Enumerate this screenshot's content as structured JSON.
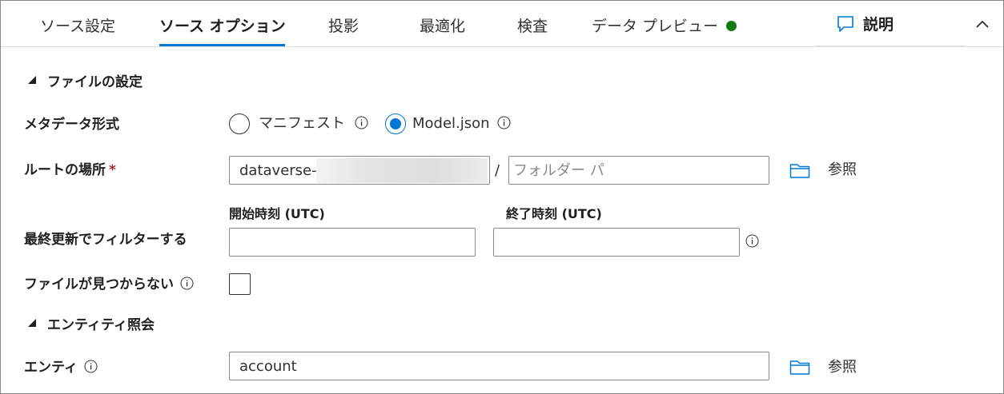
{
  "tabs": [
    {
      "label": "ソース設定",
      "active": false
    },
    {
      "label": "ソース オプション",
      "active": true
    },
    {
      "label": "投影",
      "active": false
    },
    {
      "label": "最適化",
      "active": false
    },
    {
      "label": "検査",
      "active": false
    },
    {
      "label": "データ プレビュー",
      "active": false,
      "status": "green"
    }
  ],
  "explain": {
    "label": "説明",
    "icon": "chat-bubble-icon"
  },
  "collapse": {
    "icon": "chevron-up-icon"
  },
  "file_settings": {
    "heading": "ファイルの設定",
    "metadata_format": {
      "label": "メタデータ形式",
      "options": [
        {
          "label": "マニフェスト",
          "selected": false
        },
        {
          "label": "Model.json",
          "selected": true
        }
      ]
    },
    "root_location": {
      "label": "ルートの場所",
      "required_mark": "*",
      "container_value": "dataverse-",
      "separator": "/",
      "folder_placeholder": "フォルダー パ",
      "browse_label": "参照"
    },
    "filter_last_modified": {
      "label": "最終更新でフィルターする",
      "start_label": "開始時刻 (UTC)",
      "start_value": "",
      "end_label": "終了時刻 (UTC)",
      "end_value": ""
    },
    "no_files_found": {
      "label": "ファイルが見つからない",
      "checked": false
    }
  },
  "entity_reference": {
    "heading": "エンティティ照会",
    "entity": {
      "label": "エンティ",
      "value": "account",
      "browse_label": "参照"
    }
  },
  "colors": {
    "accent": "#0078d4",
    "status_ok": "#107c10",
    "required": "#a4262c"
  }
}
